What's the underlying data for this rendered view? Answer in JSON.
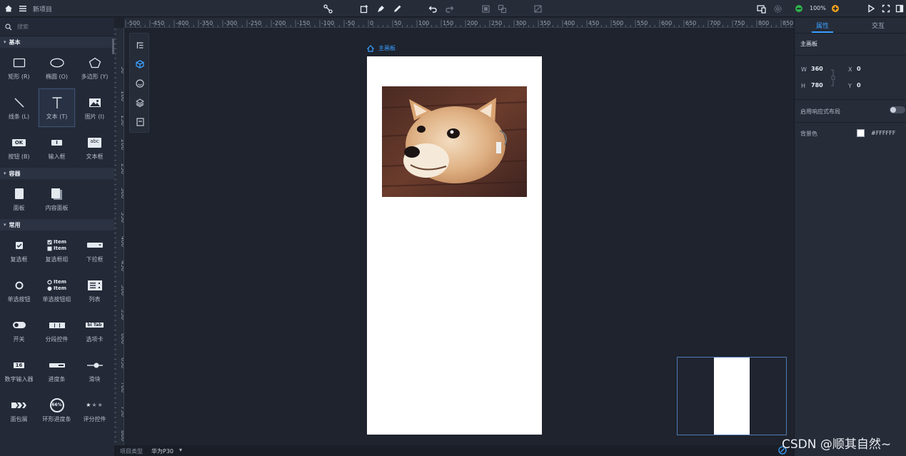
{
  "topbar": {
    "project_name": "新项目",
    "zoom": "100%",
    "colors": {
      "accent": "#3ba0ff",
      "zoom_out": "#2fb24a",
      "zoom_in": "#f2a21d"
    }
  },
  "left_panel": {
    "search_placeholder": "搜索",
    "sections": [
      {
        "title": "基本",
        "items": [
          {
            "label": "矩形 (R)",
            "icon": "rectangle-icon"
          },
          {
            "label": "椭圆 (O)",
            "icon": "ellipse-icon"
          },
          {
            "label": "多边形 (Y)",
            "icon": "polygon-icon"
          },
          {
            "label": "线条 (L)",
            "icon": "line-icon"
          },
          {
            "label": "文本 (T)",
            "icon": "text-icon"
          },
          {
            "label": "图片 (I)",
            "icon": "image-icon"
          },
          {
            "label": "按钮 (B)",
            "icon": "button-icon",
            "glyph": "OK"
          },
          {
            "label": "输入框",
            "icon": "input-icon",
            "glyph": "I"
          },
          {
            "label": "文本框",
            "icon": "textarea-icon",
            "glyph": "abc"
          }
        ]
      },
      {
        "title": "容器",
        "items": [
          {
            "label": "面板",
            "icon": "panel-icon"
          },
          {
            "label": "内容面板",
            "icon": "content-panel-icon"
          }
        ]
      },
      {
        "title": "常用",
        "items": [
          {
            "label": "复选框",
            "icon": "checkbox-icon"
          },
          {
            "label": "复选框组",
            "icon": "checkbox-group-icon",
            "glyph": "Item"
          },
          {
            "label": "下拉框",
            "icon": "dropdown-icon"
          },
          {
            "label": "单选按钮",
            "icon": "radio-icon"
          },
          {
            "label": "单选按钮组",
            "icon": "radio-group-icon",
            "glyph": "Item"
          },
          {
            "label": "列表",
            "icon": "list-icon"
          },
          {
            "label": "开关",
            "icon": "switch-icon"
          },
          {
            "label": "分段控件",
            "icon": "segmented-icon"
          },
          {
            "label": "选项卡",
            "icon": "tabs-icon",
            "glyph": "bi Tab"
          },
          {
            "label": "数字输入器",
            "icon": "number-input-icon",
            "glyph": "16"
          },
          {
            "label": "进度条",
            "icon": "progress-bar-icon"
          },
          {
            "label": "滑块",
            "icon": "slider-icon"
          },
          {
            "label": "面包屑",
            "icon": "breadcrumb-icon"
          },
          {
            "label": "环形进度条",
            "icon": "ring-progress-icon",
            "glyph": "66%"
          },
          {
            "label": "评分控件",
            "icon": "rating-icon"
          }
        ]
      }
    ]
  },
  "rulers": {
    "horizontal": [
      "-500",
      "-450",
      "-400",
      "-350",
      "-300",
      "-250",
      "-200",
      "-150",
      "-100",
      "-50",
      "0",
      "50",
      "100",
      "150",
      "200",
      "250",
      "300",
      "350",
      "400",
      "450",
      "500",
      "550",
      "600",
      "650",
      "700",
      "750",
      "800",
      "850"
    ],
    "vertical": [
      "50",
      "100",
      "150",
      "200",
      "250",
      "300",
      "350",
      "400",
      "450",
      "500",
      "550",
      "600",
      "650",
      "700",
      "750",
      "800"
    ]
  },
  "canvas": {
    "artboard_label": "主画板",
    "image_alt": "shiba inu photo"
  },
  "bottom_bar": {
    "project_type_label": "项目类型",
    "device": "华为P30"
  },
  "right_panel": {
    "tabs": [
      "属性",
      "交互"
    ],
    "title": "主画板",
    "w_label": "W",
    "w_value": "360",
    "h_label": "H",
    "h_value": "780",
    "x_label": "X",
    "x_value": "0",
    "y_label": "Y",
    "y_value": "0",
    "responsive_label": "启用响应式布局",
    "bg_label": "背景色",
    "bg_value": "#FFFFFF"
  },
  "watermark": "CSDN @顺其自然~"
}
